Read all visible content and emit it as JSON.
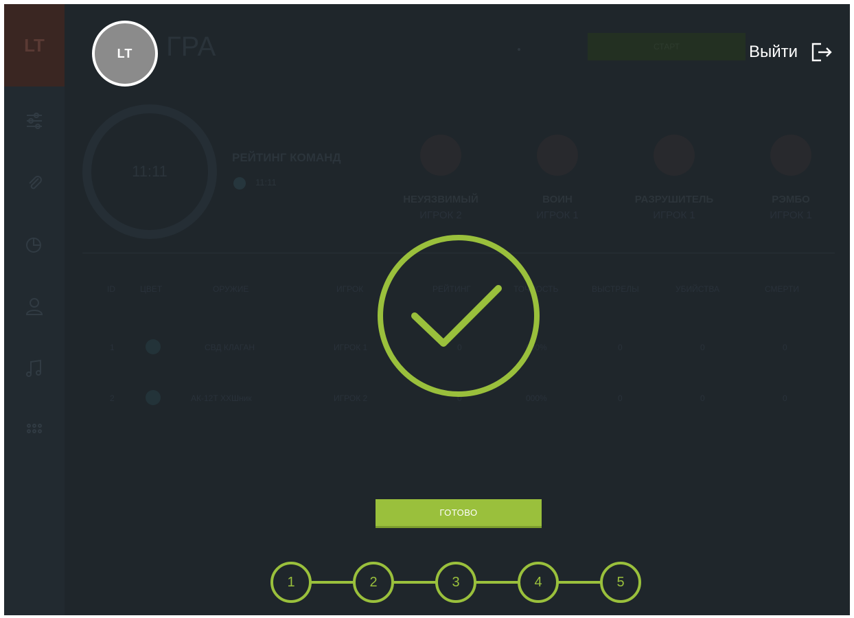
{
  "app": {
    "logo_text": "LT",
    "title_partial": "ГРА",
    "header_button": "СТАРТ"
  },
  "user": {
    "avatar_text": "LT",
    "exit_label": "Выйти"
  },
  "timer": "11:11",
  "team_rating": {
    "title": "РЕЙТИНГ КОМАНД",
    "value": "11:11"
  },
  "awards": [
    {
      "title": "НЕУЯЗВИМЫЙ",
      "player": "ИГРОК 2"
    },
    {
      "title": "ВОИН",
      "player": "ИГРОК 1"
    },
    {
      "title": "РАЗРУШИТЕЛЬ",
      "player": "ИГРОК 1"
    },
    {
      "title": "РЭМБО",
      "player": "ИГРОК 1"
    }
  ],
  "table": {
    "headers": [
      "ID",
      "ЦВЕТ",
      "ОРУЖИЕ",
      "ИГРОК",
      "РЕЙТИНГ",
      "ТОЧНОСТЬ",
      "ВЫСТРЕЛЫ",
      "УБИЙСТВА",
      "СМЕРТИ"
    ],
    "rows": [
      {
        "id": "1",
        "weapon": "СВД КЛАГАН",
        "player": "ИГРОК 1",
        "rating": "0",
        "accuracy": "000%",
        "shots": "0",
        "kills": "0",
        "deaths": "0"
      },
      {
        "id": "2",
        "weapon": "АК-12Т ХХШник",
        "player": "ИГРОК 2",
        "rating": "0",
        "accuracy": "000%",
        "shots": "0",
        "kills": "0",
        "deaths": "0"
      }
    ]
  },
  "dialog": {
    "done_label": "ГОТОВО",
    "steps": [
      "1",
      "2",
      "3",
      "4",
      "5"
    ]
  },
  "colors": {
    "accent": "#9ac03c",
    "background": "#1f262b"
  },
  "icons": {
    "exit": "exit-icon",
    "check": "check-circle-icon"
  }
}
